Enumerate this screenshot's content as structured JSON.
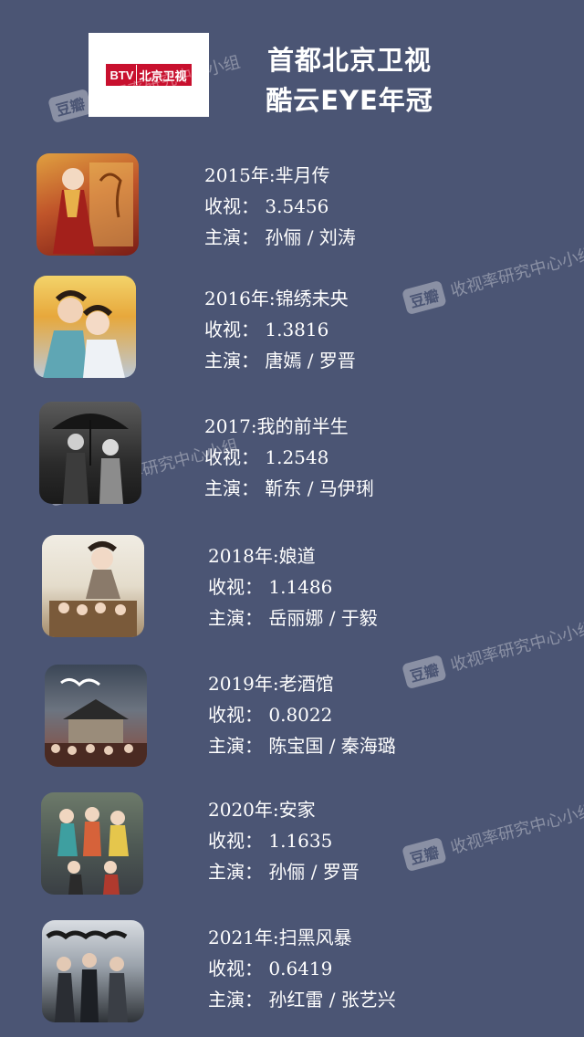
{
  "header": {
    "logo": {
      "btv": "BTV",
      "cn": "北京卫视"
    },
    "title_line1": "首都北京卫视",
    "title_line2": "酷云EYE年冠"
  },
  "watermark": {
    "logo": "豆瓣",
    "text": "收视率研究中心小组"
  },
  "entries": [
    {
      "year_title": "2015年:芈月传",
      "rating_label": "收视：",
      "rating": "3.5456",
      "cast_label": "主演：",
      "cast": "孙俪 / 刘涛"
    },
    {
      "year_title": "2016年:锦绣未央",
      "rating_label": "收视：",
      "rating": "1.3816",
      "cast_label": "主演：",
      "cast": "唐嫣 / 罗晋"
    },
    {
      "year_title": "2017:我的前半生",
      "rating_label": "收视：",
      "rating": "1.2548",
      "cast_label": "主演：",
      "cast": "靳东 / 马伊琍"
    },
    {
      "year_title": "2018年:娘道",
      "rating_label": "收视：",
      "rating": "1.1486",
      "cast_label": "主演：",
      "cast": "岳丽娜 / 于毅"
    },
    {
      "year_title": "2019年:老酒馆",
      "rating_label": "收视：",
      "rating": "0.8022",
      "cast_label": "主演：",
      "cast": "陈宝国 / 秦海璐"
    },
    {
      "year_title": "2020年:安家",
      "rating_label": "收视：",
      "rating": "1.1635",
      "cast_label": "主演：",
      "cast": "孙俪 / 罗晋"
    },
    {
      "year_title": "2021年:扫黑风暴",
      "rating_label": "收视：",
      "rating": "0.6419",
      "cast_label": "主演：",
      "cast": "孙红雷 / 张艺兴"
    }
  ]
}
